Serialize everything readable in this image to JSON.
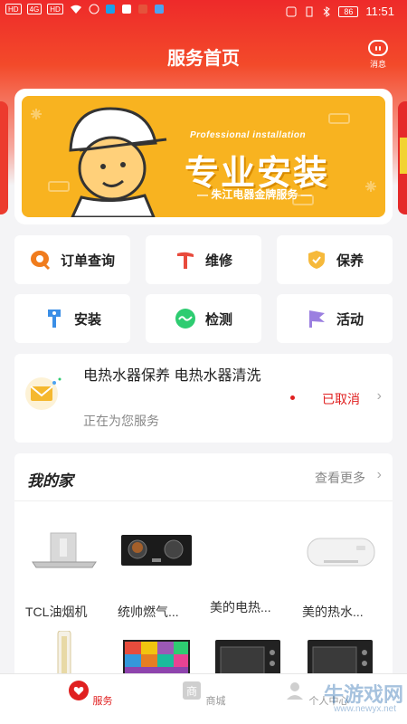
{
  "status_bar": {
    "left_chips": [
      "HD",
      "4G",
      "HD"
    ],
    "battery": "86",
    "time": "11:51"
  },
  "header": {
    "title": "服务首页",
    "messages_label": "消息"
  },
  "banner": {
    "pro_text": "Professional installation",
    "main_text": "专业安装",
    "sub_text": "— 朱江电器金牌服务 —"
  },
  "services": [
    {
      "label": "订单查询",
      "icon": "search-icon",
      "color": "#f07c1d"
    },
    {
      "label": "维修",
      "icon": "hammer-icon",
      "color": "#e84a3c"
    },
    {
      "label": "保养",
      "icon": "shield-icon",
      "color": "#f6b93b"
    },
    {
      "label": "安装",
      "icon": "tool-icon",
      "color": "#3a8ee6"
    },
    {
      "label": "检测",
      "icon": "wave-icon",
      "color": "#2ecc71"
    },
    {
      "label": "活动",
      "icon": "flag-icon",
      "color": "#9b7fe0"
    }
  ],
  "order": {
    "title": "电热水器保养 电热水器清洗",
    "subtitle": "正在为您服务",
    "status": "已取消",
    "status_color": "#e02020"
  },
  "my_home": {
    "title": "我的家",
    "more": "查看更多",
    "products": [
      {
        "name": "TCL油烟机"
      },
      {
        "name": "统帅燃气..."
      },
      {
        "name": "美的电热..."
      },
      {
        "name": "美的热水..."
      }
    ]
  },
  "bottom_nav": {
    "items": [
      {
        "label": "服务",
        "active": true
      },
      {
        "label": "商城",
        "active": false
      },
      {
        "label": "个人中心",
        "active": false
      }
    ]
  },
  "watermark": {
    "text": "牛游戏网",
    "url": "www.newyx.net"
  },
  "colors": {
    "brand_red": "#ee2a2a",
    "banner_yellow": "#f8b320"
  }
}
